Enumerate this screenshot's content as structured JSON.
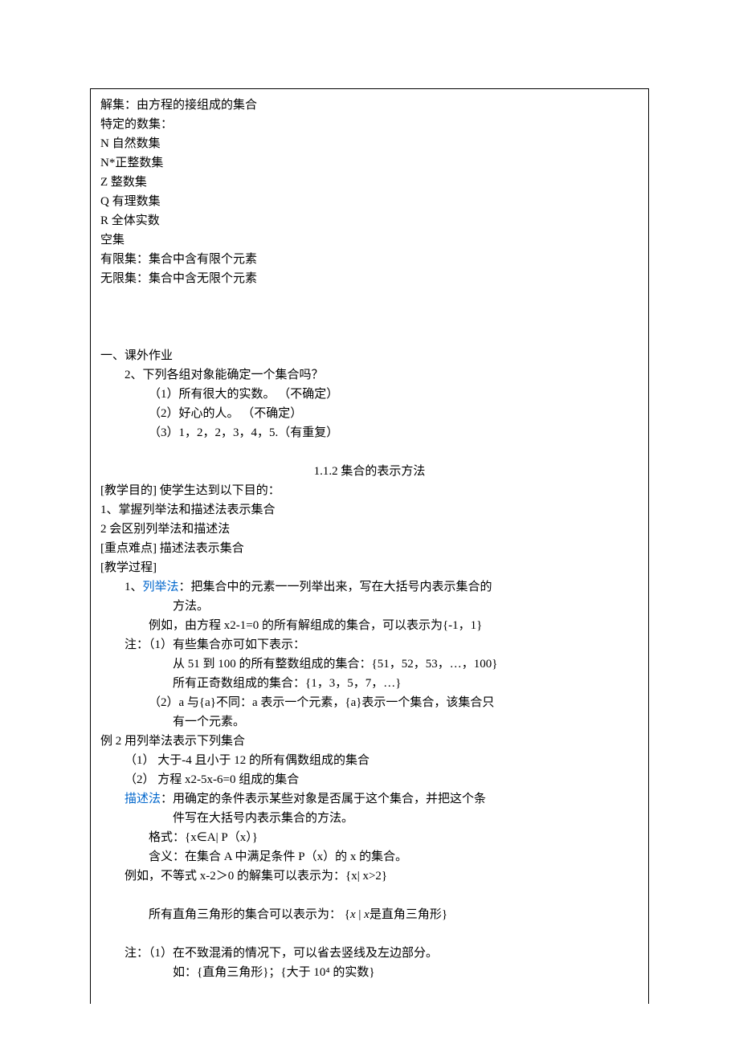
{
  "top": {
    "l1": "解集：由方程的接组成的集合",
    "l2": "特定的数集：",
    "l3": "N 自然数集",
    "l4": "N*正整数集",
    "l5": "Z 整数集",
    "l6": "Q 有理数集",
    "l7": "R 全体实数",
    "l8": "空集",
    "l9": "有限集：集合中含有限个元素",
    "l10": "无限集：集合中含无限个元素"
  },
  "hw": {
    "head": "一、课外作业",
    "q": "2、下列各组对象能确定一个集合吗？",
    "a1": "（1）所有很大的实数。  （不确定）",
    "a2": "（2）好心的人。        （不确定）",
    "a3": "（3）1，2，2，3，4，5.（有重复）"
  },
  "section_title": "1.1.2 集合的表示方法",
  "aims": {
    "head": "[教学目的]  使学生达到以下目的：",
    "a1": "1、掌握列举法和描述法表示集合",
    "a2": "2 会区别列举法和描述法"
  },
  "diff": "[重点难点] 描述法表示集合",
  "proc": "[教学过程]",
  "enum": {
    "lead_pre": "1、",
    "lead_key": "列举法",
    "lead_post": "：把集合中的元素一一列举出来，写在大括号内表示集合的",
    "lead_cont": "方法。",
    "ex": "例如，由方程 x2-1=0 的所有解组成的集合，可以表示为{-1，1}",
    "note_head": "注：（1）有些集合亦可如下表示：",
    "note1": "从 51 到 100 的所有整数组成的集合：{51，52，53，…，100}",
    "note2": "所有正奇数组成的集合：{1，3，5，7，…}",
    "note3": "（2）a 与{a}不同：a 表示一个元素，{a}表示一个集合，该集合只",
    "note3b": "有一个元素。"
  },
  "ex2": {
    "head": "例 2 用列举法表示下列集合",
    "i1": "（1）   大于-4 且小于 12 的所有偶数组成的集合",
    "i2": "（2）   方程 x2-5x-6=0 组成的集合"
  },
  "desc": {
    "key": "描述法",
    "lead": "：用确定的条件表示某些对象是否属于这个集合，并把这个条",
    "lead2": "件写在大括号内表示集合的方法。",
    "fmt": "格式：{x∈A| P（x）}",
    "mean": "含义：在集合 A 中满足条件 P（x）的 x 的集合。",
    "ex": "例如，不等式 x-2＞0 的解集可以表示为：{x| x>2}",
    "tri_pre": "所有直角三角形的集合可以表示为：",
    "tri_formula_l": "{",
    "tri_formula_var": "x",
    "tri_formula_mid": " | ",
    "tri_formula_var2": "x",
    "tri_formula_r": "是直角三角形}",
    "note_head": "注：（1）在不致混淆的情况下，可以省去竖线及左边部分。",
    "note1": "如：{直角三角形}；{大于 10⁴ 的实数}"
  }
}
